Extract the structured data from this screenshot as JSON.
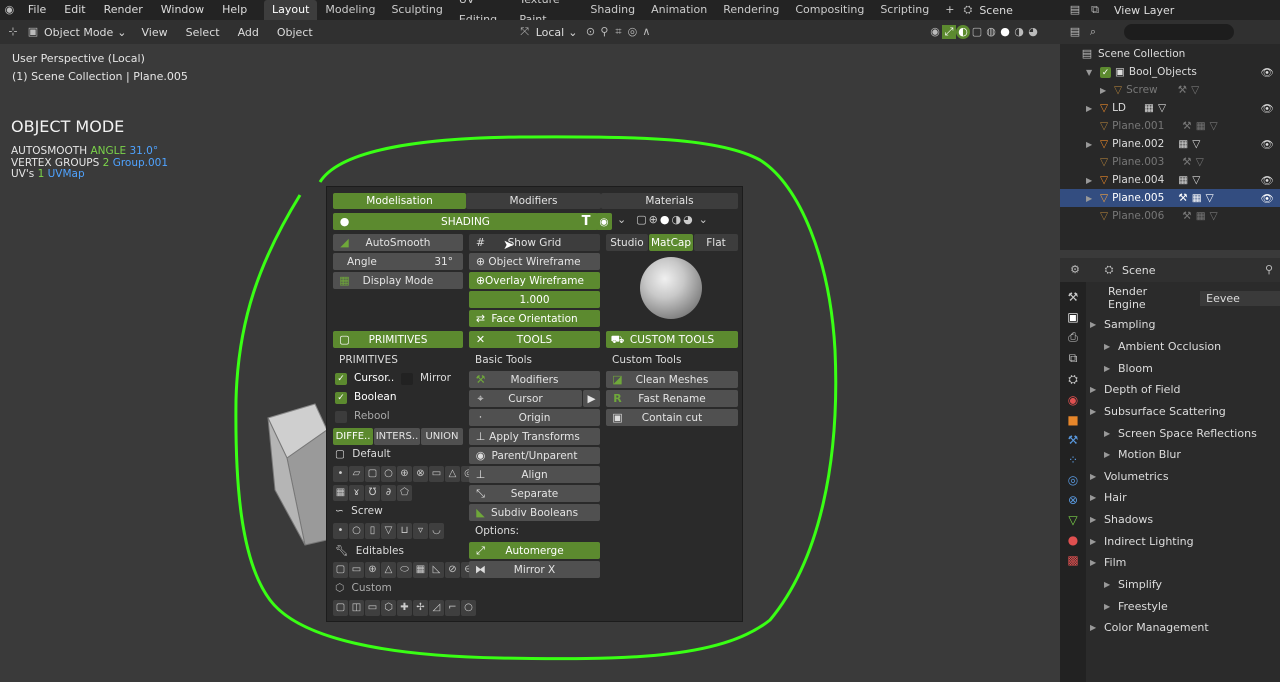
{
  "topbar": {
    "menus": [
      "File",
      "Edit",
      "Render",
      "Window",
      "Help"
    ],
    "workspaces": [
      "Layout",
      "Modeling",
      "Sculpting",
      "UV Editing",
      "Texture Paint",
      "Shading",
      "Animation",
      "Rendering",
      "Compositing",
      "Scripting"
    ],
    "active_workspace": "Layout",
    "add": "+",
    "scene": "Scene",
    "view_layer": "View Layer"
  },
  "header": {
    "mode": "Object Mode",
    "menus": [
      "View",
      "Select",
      "Add",
      "Object"
    ],
    "transform_orientation": "Local"
  },
  "viewport": {
    "perspective": "User Perspective (Local)",
    "collection_path": "(1) Scene Collection | Plane.005",
    "mode_title": "OBJECT MODE",
    "autosmooth_label": "AUTOSMOOTH",
    "angle_label": "ANGLE",
    "angle_value": "31.0°",
    "vgroups_label": "VERTEX GROUPS",
    "vgroups_count": "2",
    "vgroups_name": "Group.001",
    "uvs_label": "UV's",
    "uvs_count": "1",
    "uvs_name": "UVMap"
  },
  "outliner": {
    "root": "Scene Collection",
    "items": [
      {
        "name": "Bool_Objects",
        "dim": false
      },
      {
        "name": "Screw",
        "dim": true
      },
      {
        "name": "LD",
        "dim": false
      },
      {
        "name": "Plane.001",
        "dim": true
      },
      {
        "name": "Plane.002",
        "dim": false
      },
      {
        "name": "Plane.003",
        "dim": true
      },
      {
        "name": "Plane.004",
        "dim": false
      },
      {
        "name": "Plane.005",
        "dim": false
      },
      {
        "name": "Plane.006",
        "dim": true
      }
    ]
  },
  "properties": {
    "title": "Scene",
    "render_engine_label": "Render Engine",
    "render_engine": "Eevee",
    "sections": [
      "Sampling",
      "Ambient Occlusion",
      "Bloom",
      "Depth of Field",
      "Subsurface Scattering",
      "Screen Space Reflections",
      "Motion Blur",
      "Volumetrics",
      "Hair",
      "Shadows",
      "Indirect Lighting",
      "Film",
      "Simplify",
      "Freestyle",
      "Color Management"
    ]
  },
  "panel": {
    "tabs": [
      "Modelisation",
      "Modifiers",
      "Materials"
    ],
    "shading": "SHADING",
    "autosmooth": "AutoSmooth",
    "angle_label": "Angle",
    "angle_value": "31°",
    "display_mode": "Display Mode",
    "show_grid": "Show Grid",
    "object_wireframe": "Object Wireframe",
    "overlay_wireframe": "Overlay Wireframe",
    "wire_value": "1.000",
    "face_orientation": "Face Orientation",
    "studio": "Studio",
    "matcap": "MatCap",
    "flat": "Flat",
    "sec_primitives": "PRIMITIVES",
    "sec_tools": "TOOLS",
    "sec_custom_tools": "CUSTOM TOOLS",
    "primitives_label": "PRIMITIVES",
    "cursor": "Cursor..",
    "mirror": "Mirror",
    "boolean": "Boolean",
    "rebool": "Rebool",
    "bool_modes": [
      "DIFFE..",
      "INTERS..",
      "UNION"
    ],
    "default": "Default",
    "screw": "Screw",
    "editables": "Editables",
    "custom": "Custom",
    "basic_tools_label": "Basic Tools",
    "basic_tools": [
      "Modifiers",
      "Cursor",
      "Origin",
      "Apply Transforms",
      "Parent/Unparent",
      "Align",
      "Separate",
      "Subdiv Booleans"
    ],
    "options_label": "Options:",
    "automerge": "Automerge",
    "mirror_x": "Mirror X",
    "custom_tools_label": "Custom Tools",
    "custom_tools": [
      "Clean Meshes",
      "Fast Rename",
      "Contain cut"
    ]
  },
  "colors": {
    "accent_green": "#5c8a2f",
    "annotation": "#39ff14",
    "selected_row": "#334d80"
  }
}
